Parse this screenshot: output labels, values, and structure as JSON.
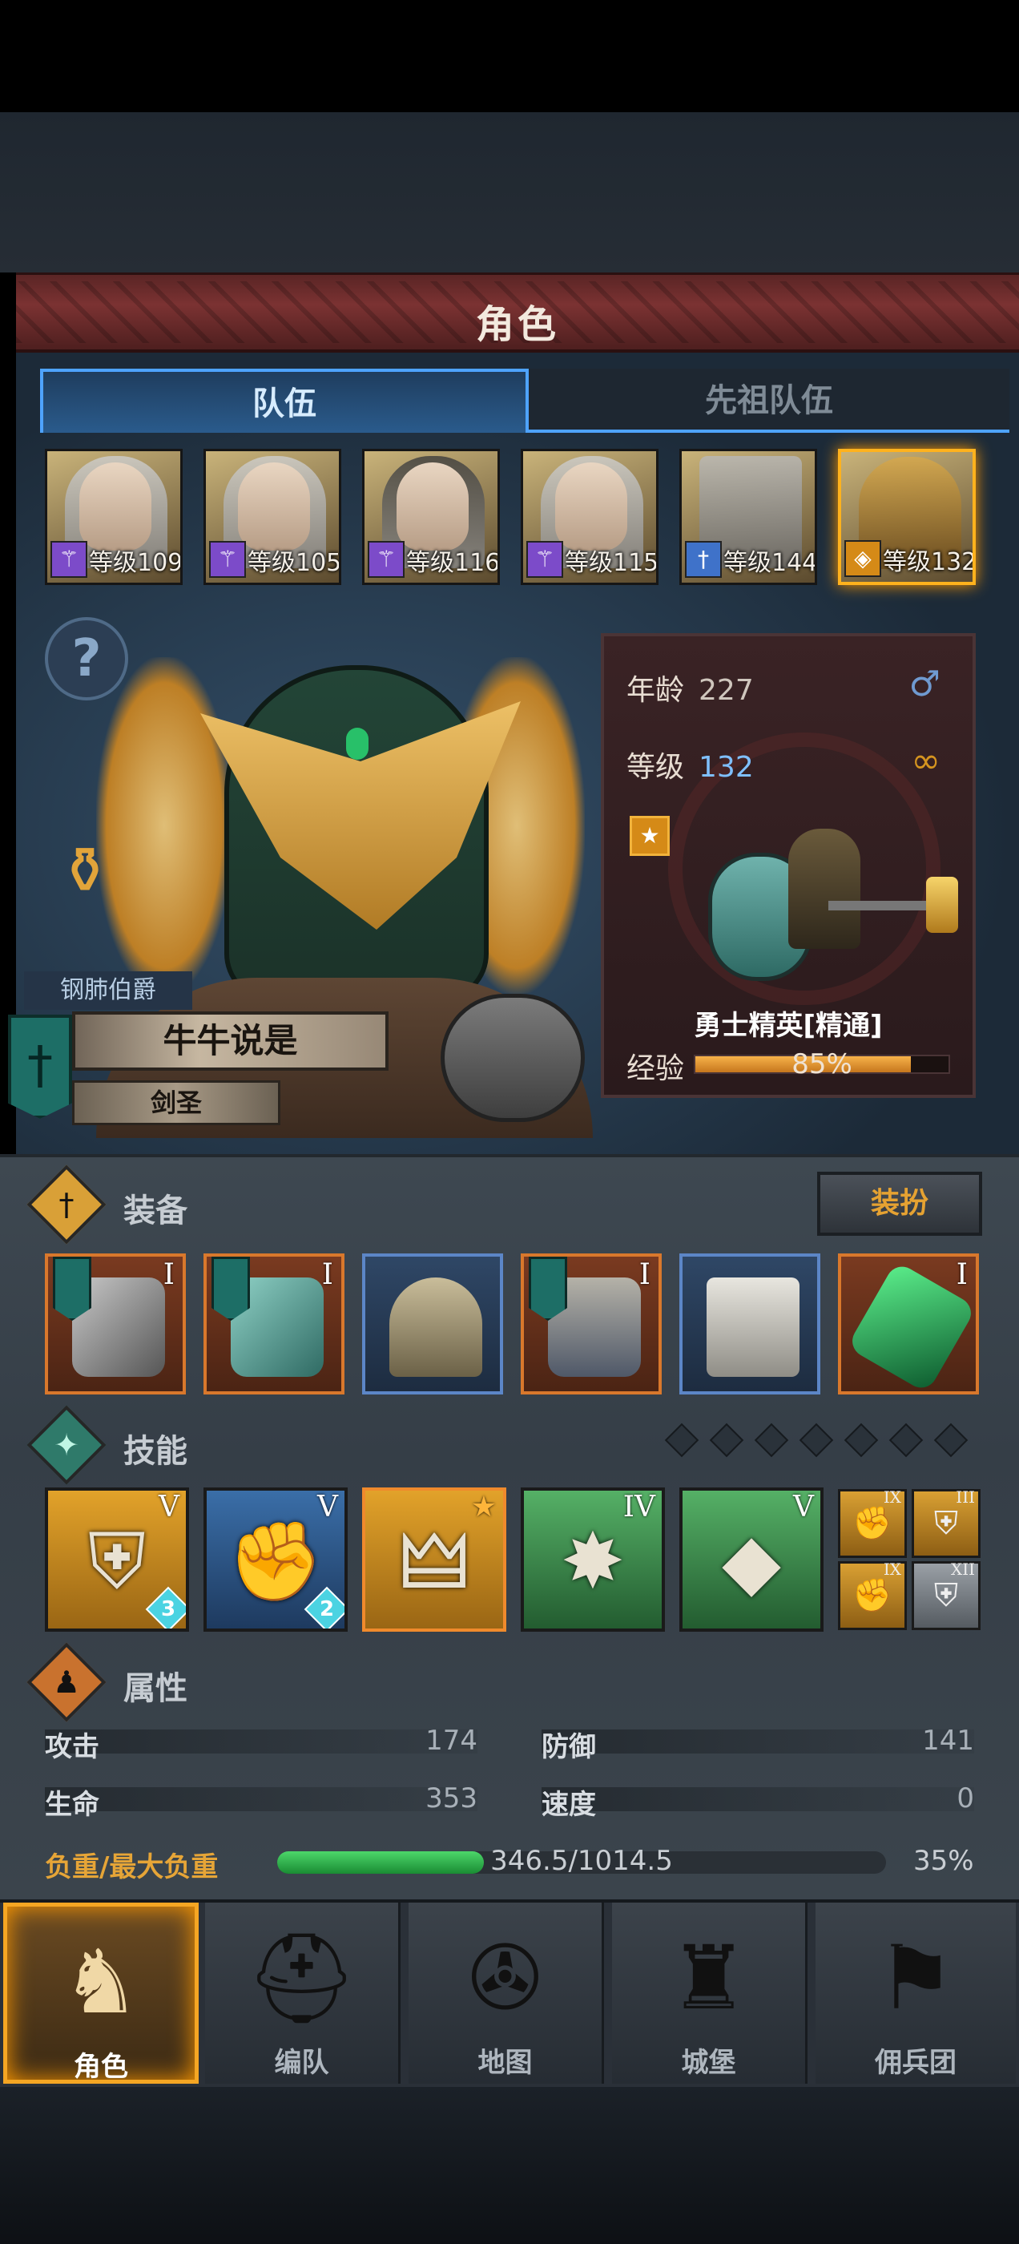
{
  "title": "角色",
  "tabs": [
    {
      "label": "队伍",
      "active": true
    },
    {
      "label": "先祖队伍",
      "active": false
    }
  ],
  "party": [
    {
      "class_icon": "staff-icon",
      "level_text": "等级109"
    },
    {
      "class_icon": "staff-icon",
      "level_text": "等级105"
    },
    {
      "class_icon": "staff-icon",
      "level_text": "等级116"
    },
    {
      "class_icon": "staff-icon",
      "level_text": "等级115"
    },
    {
      "class_icon": "sword-icon",
      "level_text": "等级144"
    },
    {
      "class_icon": "shield-icon",
      "level_text": "等级132",
      "selected": true
    }
  ],
  "hero": {
    "rank": "钢肺伯爵",
    "name": "牛牛说是",
    "class": "剑圣"
  },
  "info": {
    "age_label": "年龄",
    "age_value": "227",
    "level_label": "等级",
    "level_value": "132",
    "unit_name": "勇士精英[精通]",
    "exp_label": "经验",
    "exp_text": "85%",
    "exp_fraction": 0.85,
    "gender_icon": "male-icon",
    "ring_icon": "ring-icon"
  },
  "equipment": {
    "title": "装备",
    "dress_label": "装扮",
    "slots": [
      {
        "name": "hammer",
        "tier": "I",
        "flag": true,
        "style": "orange"
      },
      {
        "name": "shield",
        "tier": "I",
        "flag": true,
        "style": "orange"
      },
      {
        "name": "helmet",
        "tier": "",
        "flag": false,
        "style": "blue"
      },
      {
        "name": "armor",
        "tier": "I",
        "flag": true,
        "style": "orange"
      },
      {
        "name": "boots",
        "tier": "",
        "flag": false,
        "style": "blue"
      },
      {
        "name": "crystal",
        "tier": "I",
        "flag": false,
        "style": "orange"
      }
    ]
  },
  "skills": {
    "title": "技能",
    "items": [
      {
        "tier": "V",
        "level": "3",
        "style": "gold"
      },
      {
        "tier": "V",
        "level": "2",
        "style": "blue"
      },
      {
        "tier": "",
        "level": "",
        "style": "gold"
      },
      {
        "tier": "IV",
        "level": "",
        "style": "green"
      },
      {
        "tier": "V",
        "level": "",
        "style": "green"
      }
    ],
    "mini": [
      {
        "tier": "IX"
      },
      {
        "tier": "III"
      },
      {
        "tier": "IX"
      },
      {
        "tier": "XII"
      }
    ],
    "slots_total": 7
  },
  "attributes": {
    "title": "属性",
    "attack_label": "攻击",
    "attack_value": "174",
    "defense_label": "防御",
    "defense_value": "141",
    "hp_label": "生命",
    "hp_value": "353",
    "speed_label": "速度",
    "speed_value": "0",
    "load_label": "负重/最大负重",
    "load_text": "346.5/1014.5",
    "load_fraction": 0.34,
    "load_pct": "35%"
  },
  "nav": [
    {
      "label": "角色",
      "icon": "knight-icon",
      "active": true
    },
    {
      "label": "编队",
      "icon": "helmet-icon",
      "active": false
    },
    {
      "label": "地图",
      "icon": "compass-icon",
      "active": false
    },
    {
      "label": "城堡",
      "icon": "castle-icon",
      "active": false
    },
    {
      "label": "佣兵团",
      "icon": "mercenary-icon",
      "active": false
    }
  ],
  "colors": {
    "accent_gold": "#f5a623",
    "tab_blue": "#4ea3ff",
    "title_red": "#7b3232",
    "load_green": "#4cd66a"
  }
}
